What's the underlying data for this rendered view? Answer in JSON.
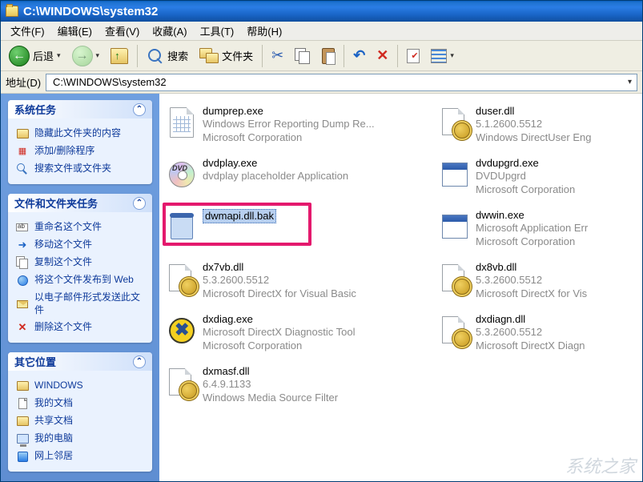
{
  "title": "C:\\WINDOWS\\system32",
  "menu": {
    "file": "文件(F)",
    "edit": "编辑(E)",
    "view": "查看(V)",
    "favorites": "收藏(A)",
    "tools": "工具(T)",
    "help": "帮助(H)"
  },
  "toolbar": {
    "back": "后退",
    "search": "搜索",
    "folders": "文件夹"
  },
  "address": {
    "label": "地址(D)",
    "path": "C:\\WINDOWS\\system32"
  },
  "sidebar": {
    "system_tasks": {
      "title": "系统任务",
      "hide": "隐藏此文件夹的内容",
      "add_remove": "添加/删除程序",
      "search": "搜索文件或文件夹"
    },
    "file_tasks": {
      "title": "文件和文件夹任务",
      "rename": "重命名这个文件",
      "move": "移动这个文件",
      "copy": "复制这个文件",
      "publish": "将这个文件发布到 Web",
      "email": "以电子邮件形式发送此文件",
      "delete": "删除这个文件"
    },
    "other_places": {
      "title": "其它位置",
      "windows": "WINDOWS",
      "my_docs": "我的文档",
      "shared": "共享文档",
      "my_pc": "我的电脑",
      "network": "网上邻居"
    }
  },
  "files": [
    {
      "name": "dumprep.exe",
      "line2": "Windows Error Reporting Dump Re...",
      "line3": "Microsoft Corporation",
      "icon": "page-grid"
    },
    {
      "name": "duser.dll",
      "line2": "5.1.2600.5512",
      "line3": "Windows DirectUser Eng",
      "icon": "gear"
    },
    {
      "name": "dvdplay.exe",
      "line2": "dvdplay placeholder Application",
      "line3": "",
      "icon": "dvd"
    },
    {
      "name": "dvdupgrd.exe",
      "line2": "DVDUpgrd",
      "line3": "Microsoft Corporation",
      "icon": "app"
    },
    {
      "name": "dwmapi.dll.bak",
      "line2": "",
      "line3": "",
      "icon": "bluebin",
      "selected": true
    },
    {
      "name": "dwwin.exe",
      "line2": "Microsoft Application Err",
      "line3": "Microsoft Corporation",
      "icon": "app"
    },
    {
      "name": "dx7vb.dll",
      "line2": "5.3.2600.5512",
      "line3": "Microsoft DirectX for Visual Basic",
      "icon": "gear"
    },
    {
      "name": "dx8vb.dll",
      "line2": "5.3.2600.5512",
      "line3": "Microsoft DirectX for Vis",
      "icon": "gear"
    },
    {
      "name": "dxdiag.exe",
      "line2": "Microsoft DirectX Diagnostic Tool",
      "line3": "Microsoft Corporation",
      "icon": "dxdiag"
    },
    {
      "name": "dxdiagn.dll",
      "line2": "5.3.2600.5512",
      "line3": "Microsoft DirectX Diagn",
      "icon": "gear"
    },
    {
      "name": "dxmasf.dll",
      "line2": "6.4.9.1133",
      "line3": "Windows Media Source Filter",
      "icon": "gear"
    }
  ],
  "highlight_file_index": 4,
  "watermark": "系统之家"
}
